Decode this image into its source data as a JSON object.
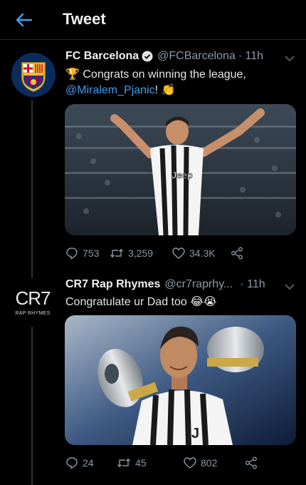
{
  "header": {
    "title": "Tweet"
  },
  "tweets": [
    {
      "name": "FC Barcelona",
      "handle": "@FCBarcelona",
      "time": "· 11h",
      "trophy_emoji": "🏆",
      "text_before": "Congrats on winning the league,",
      "mention": "@Miralem_Pjanic",
      "text_after": "!",
      "end_emoji": "👏",
      "replies": "753",
      "retweets": "3,259",
      "likes": "34.3K"
    },
    {
      "name": "CR7 Rap Rhymes",
      "handle": "@cr7raprhy...",
      "time": "· 11h",
      "text": "Congratulate ur Dad too",
      "emojis": "😂😭",
      "avatar_logo": "CR7",
      "avatar_sub": "RAP RHYMES",
      "replies": "24",
      "retweets": "45",
      "likes": "802"
    }
  ],
  "colors": {
    "accent": "#3fa0ef",
    "muted": "#8b98a5",
    "background": "#000000"
  },
  "icons": [
    "back-arrow-icon",
    "verified-icon",
    "chevron-down-icon",
    "reply-icon",
    "retweet-icon",
    "like-icon",
    "share-icon"
  ]
}
